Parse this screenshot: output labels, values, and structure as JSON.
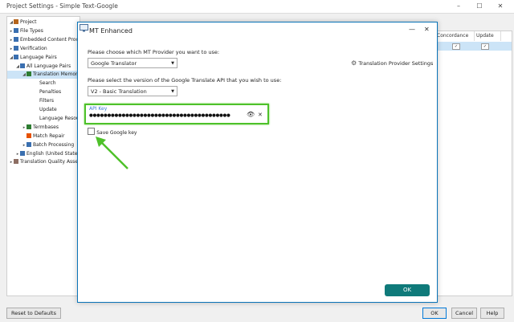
{
  "window": {
    "title": "Project Settings - Simple Text-Google",
    "min_glyph": "–",
    "max_glyph": "☐",
    "close_glyph": "✕"
  },
  "tree": [
    {
      "label": "Project",
      "indent": 0,
      "expander": "◢"
    },
    {
      "label": "File Types",
      "indent": 0,
      "expander": "▸"
    },
    {
      "label": "Embedded Content Proc",
      "indent": 0,
      "expander": "▸"
    },
    {
      "label": "Verification",
      "indent": 0,
      "expander": "▸"
    },
    {
      "label": "Language Pairs",
      "indent": 0,
      "expander": "◢"
    },
    {
      "label": "All Language Pairs",
      "indent": 1,
      "expander": "◢"
    },
    {
      "label": "Translation Memor",
      "indent": 2,
      "expander": "◢",
      "selected": true
    },
    {
      "label": "Search",
      "indent": 3,
      "expander": ""
    },
    {
      "label": "Penalties",
      "indent": 3,
      "expander": ""
    },
    {
      "label": "Filters",
      "indent": 3,
      "expander": ""
    },
    {
      "label": "Update",
      "indent": 3,
      "expander": ""
    },
    {
      "label": "Language Resourc",
      "indent": 3,
      "expander": ""
    },
    {
      "label": "Termbases",
      "indent": 2,
      "expander": "▸"
    },
    {
      "label": "Match Repair",
      "indent": 2,
      "expander": ""
    },
    {
      "label": "Batch Processing",
      "indent": 2,
      "expander": "▸"
    },
    {
      "label": "English (United States",
      "indent": 1,
      "expander": "▸"
    },
    {
      "label": "Translation Quality Asses",
      "indent": 0,
      "expander": "▸"
    }
  ],
  "grid": {
    "headers": [
      "Concordance",
      "Update"
    ],
    "row": [
      "✓",
      "✓"
    ]
  },
  "footer": {
    "reset": "Reset to Defaults",
    "ok": "OK",
    "cancel": "Cancel",
    "help": "Help"
  },
  "dialog": {
    "title": "MT Enhanced",
    "min_glyph": "—",
    "close_glyph": "✕",
    "provider_prompt": "Please choose which MT Provider you want to use:",
    "provider_value": "Google Translator",
    "provider_settings_label": "Translation Provider Settings",
    "api_version_prompt": "Please select the version of the Google Translate API that you wish to use:",
    "api_version_value": "V2 - Basic Translation",
    "api_key_label": "API Key",
    "api_key_value": "●●●●●●●●●●●●●●●●●●●●●●●●●●●●●●●●●●●●●●●",
    "save_key_label": "Save Google key",
    "ok_label": "OK"
  },
  "colors": {
    "highlight_green": "#4ec12a",
    "ok_button": "#0f7a7a",
    "dialog_border": "#0a74b8",
    "api_key_label": "#3a7ad1"
  }
}
